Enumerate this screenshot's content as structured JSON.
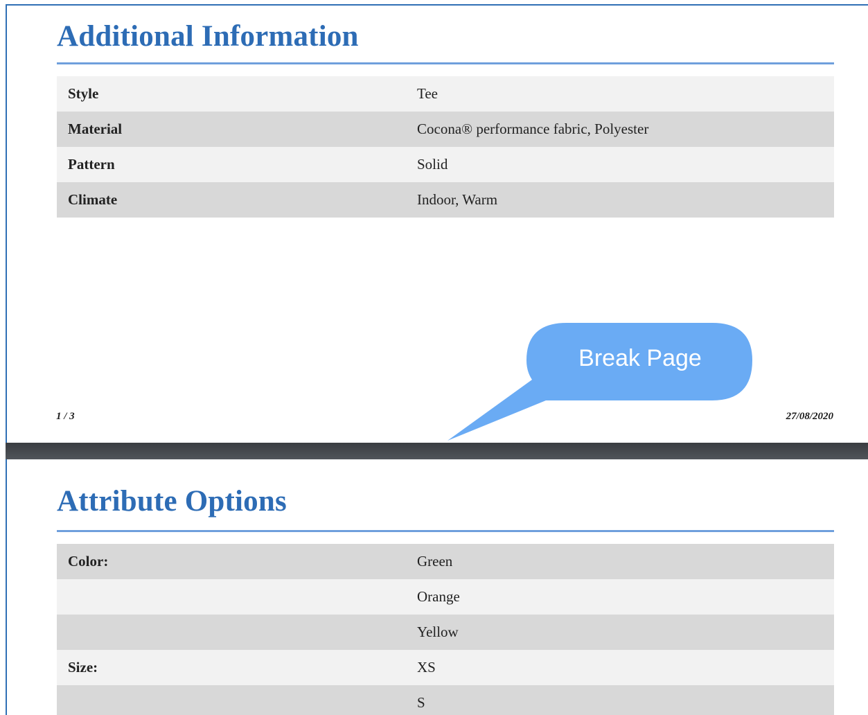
{
  "pages": [
    {
      "section_title": "Additional Information",
      "rows": [
        {
          "label": "Style",
          "value": "Tee"
        },
        {
          "label": "Material",
          "value": "Cocona® performance fabric, Polyester"
        },
        {
          "label": "Pattern",
          "value": "Solid"
        },
        {
          "label": "Climate",
          "value": "Indoor, Warm"
        }
      ],
      "footer": {
        "page_number": "1 / 3",
        "date": "27/08/2020"
      }
    },
    {
      "section_title": "Attribute Options",
      "rows": [
        {
          "label": "Color:",
          "value": "Green"
        },
        {
          "label": "",
          "value": "Orange"
        },
        {
          "label": "",
          "value": "Yellow"
        },
        {
          "label": "Size:",
          "value": "XS"
        },
        {
          "label": "",
          "value": "S"
        }
      ]
    }
  ],
  "callout": {
    "text": "Break Page",
    "color": "#6aabf4"
  },
  "colors": {
    "heading": "#2d6cb5",
    "rule": "#6f9fdc",
    "row_light": "#f2f2f2",
    "row_dark": "#d8d8d8",
    "page_gap": "#3a3d41"
  }
}
